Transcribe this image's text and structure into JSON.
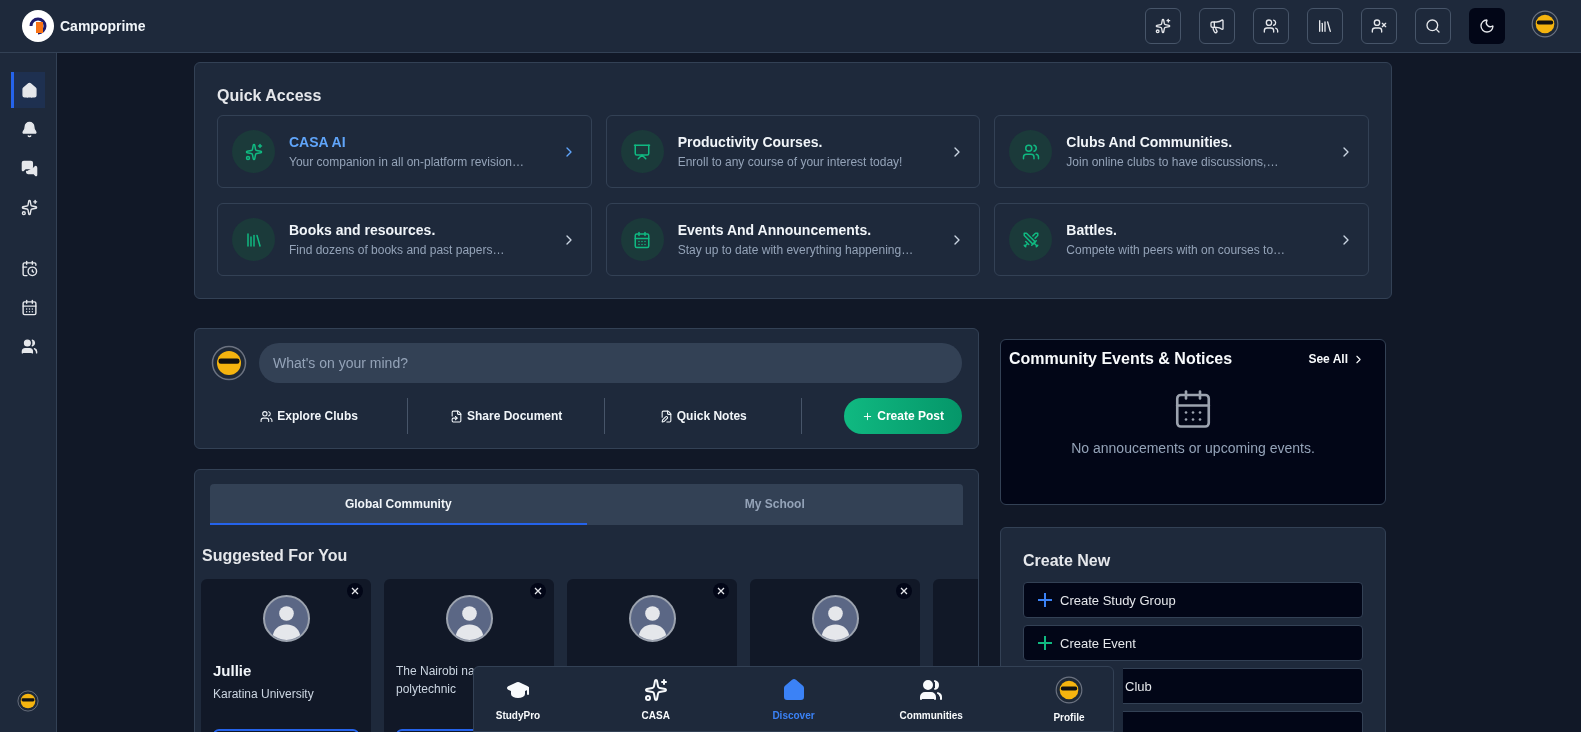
{
  "app": {
    "name": "Campoprime"
  },
  "top_actions": [
    {
      "selected": false
    },
    {
      "selected": false
    },
    {
      "selected": false
    },
    {
      "selected": false
    },
    {
      "selected": false
    },
    {
      "selected": false
    },
    {
      "selected": true
    }
  ],
  "sidebar": {
    "items": [
      {
        "selected": true
      },
      {
        "selected": false
      },
      {
        "selected": false
      },
      {
        "selected": false
      },
      {
        "selected": false
      },
      {
        "selected": false
      },
      {
        "selected": false
      }
    ]
  },
  "quick_access": {
    "title": "Quick Access",
    "items": [
      {
        "title": "CASA AI",
        "subtitle": "Your companion in all on-platform revision…",
        "selected": true
      },
      {
        "title": "Productivity Courses.",
        "subtitle": "Enroll to any course of your interest today!",
        "selected": false
      },
      {
        "title": "Clubs And Communities.",
        "subtitle": "Join online clubs to have discussions,…",
        "selected": false
      },
      {
        "title": "Books and resources.",
        "subtitle": "Find dozens of books and past papers…",
        "selected": false
      },
      {
        "title": "Events And Announcements.",
        "subtitle": "Stay up to date with everything happening…",
        "selected": false
      },
      {
        "title": "Battles.",
        "subtitle": "Compete with peers with on courses to…",
        "selected": false
      }
    ]
  },
  "composer": {
    "placeholder": "What's on your mind?",
    "actions": [
      "Explore Clubs",
      "Share Document",
      "Quick Notes"
    ],
    "create_post": "Create Post"
  },
  "tabs": [
    {
      "label": "Global Community",
      "selected": true
    },
    {
      "label": "My School",
      "selected": false
    }
  ],
  "suggested": {
    "title": "Suggested For You",
    "cards": [
      {
        "name": "Jullie",
        "lines": [
          "Karatina University"
        ],
        "dismissible": true
      },
      {
        "lines": [
          "The Nairobi na",
          "polytechnic"
        ],
        "dismissible": true
      },
      {
        "dismissible": true
      },
      {
        "dismissible": true
      }
    ]
  },
  "events": {
    "title": "Community Events & Notices",
    "see_all": "See All",
    "empty": "No annoucements or upcoming events."
  },
  "create_new": {
    "title": "Create New",
    "items": [
      {
        "label": "Create Study Group",
        "color": "#3b82f6"
      },
      {
        "label": "Create Event",
        "color": "#10b981"
      },
      {
        "label": "Club"
      }
    ]
  },
  "bottom_nav": {
    "items": [
      {
        "label": "StudyPro",
        "selected": false
      },
      {
        "label": "CASA",
        "selected": false
      },
      {
        "label": "Discover",
        "selected": true
      },
      {
        "label": "Communities",
        "selected": false
      },
      {
        "label": "Profile",
        "selected": false
      }
    ]
  }
}
